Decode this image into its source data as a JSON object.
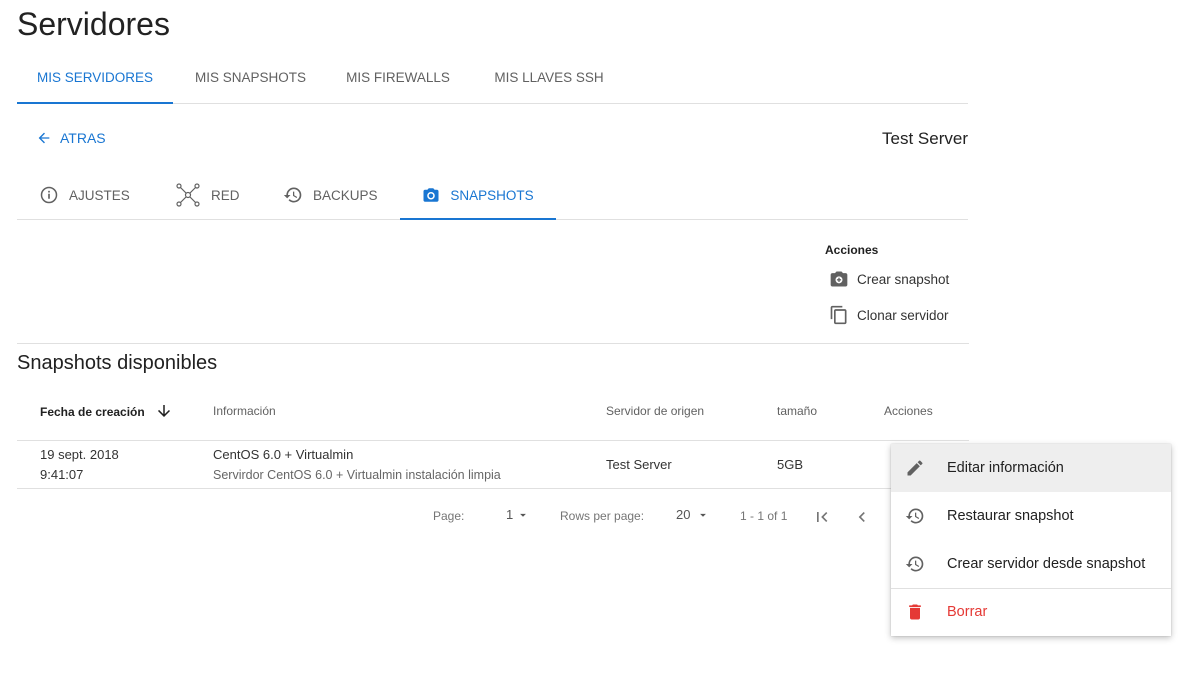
{
  "page": {
    "title": "Servidores"
  },
  "top_tabs": [
    {
      "label": "MIS SERVIDORES",
      "active": true
    },
    {
      "label": "MIS SNAPSHOTS",
      "active": false
    },
    {
      "label": "MIS FIREWALLS",
      "active": false
    },
    {
      "label": "MIS LLAVES SSH",
      "active": false
    }
  ],
  "back": {
    "label": "ATRAS"
  },
  "server": {
    "name": "Test Server"
  },
  "sub_tabs": [
    {
      "label": "AJUSTES",
      "icon": "info-icon",
      "active": false
    },
    {
      "label": "RED",
      "icon": "network-icon",
      "active": false
    },
    {
      "label": "BACKUPS",
      "icon": "history-icon",
      "active": false
    },
    {
      "label": "SNAPSHOTS",
      "icon": "camera-icon",
      "active": true
    }
  ],
  "actions": {
    "title": "Acciones",
    "items": [
      {
        "label": "Crear snapshot",
        "icon": "add-camera-icon"
      },
      {
        "label": "Clonar servidor",
        "icon": "copy-icon"
      }
    ]
  },
  "snapshots": {
    "title": "Snapshots disponibles",
    "columns": [
      "Fecha de creación",
      "Información",
      "Servidor de origen",
      "tamaño",
      "Acciones"
    ],
    "rows": [
      {
        "date": "19 sept. 2018",
        "time": "9:41:07",
        "info_title": "CentOS 6.0 + Virtualmin",
        "info_desc": "Servirdor CentOS 6.0 + Virtualmin instalación limpia",
        "origin": "Test Server",
        "size": "5GB"
      }
    ]
  },
  "pagination": {
    "page_label": "Page:",
    "page_value": "1",
    "rows_label": "Rows per page:",
    "rows_value": "20",
    "range": "1 - 1 of 1"
  },
  "context_menu": {
    "items": [
      {
        "label": "Editar información",
        "icon": "pencil-icon"
      },
      {
        "label": "Restaurar snapshot",
        "icon": "history-icon"
      },
      {
        "label": "Crear servidor desde snapshot",
        "icon": "history-icon"
      },
      {
        "label": "Borrar",
        "icon": "trash-icon"
      }
    ]
  },
  "colors": {
    "accent": "#1976d2",
    "danger": "#e53935",
    "divider": "#e0e0e0"
  }
}
